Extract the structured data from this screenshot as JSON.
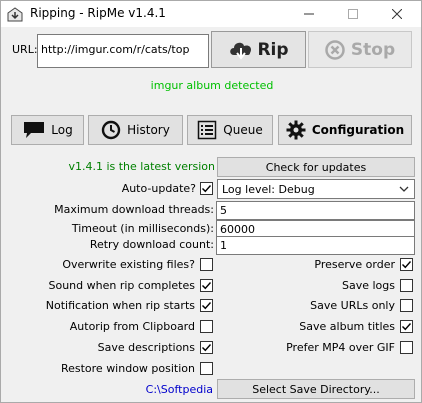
{
  "window": {
    "title": "Ripping - RipMe v1.4.1"
  },
  "url": {
    "label": "URL:",
    "value": "http://imgur.com/r/cats/top"
  },
  "rip_button": {
    "label": "Rip",
    "icon": "cloud-download-icon"
  },
  "stop_button": {
    "label": "Stop",
    "icon": "cancel-icon"
  },
  "status": {
    "text": "imgur album detected",
    "color": "#00c000"
  },
  "tabs": [
    {
      "label": "Log",
      "icon": "speech-bubble-icon"
    },
    {
      "label": "History",
      "icon": "clock-icon"
    },
    {
      "label": "Queue",
      "icon": "list-icon"
    },
    {
      "label": "Configuration",
      "icon": "gear-icon"
    }
  ],
  "config": {
    "version_text": "v1.4.1 is the latest version",
    "version_color": "#008000",
    "check_updates_label": "Check for updates",
    "auto_update_label": "Auto-update?",
    "auto_update_checked": true,
    "log_level_value": "Log level: Debug",
    "threads_label": "Maximum download threads:",
    "threads_value": "5",
    "timeout_label": "Timeout (in milliseconds):",
    "timeout_value": "60000",
    "retry_label": "Retry download count:",
    "retry_value": "1",
    "left_options": [
      {
        "label": "Overwrite existing files?",
        "checked": false
      },
      {
        "label": "Sound when rip completes",
        "checked": true
      },
      {
        "label": "Notification when rip starts",
        "checked": true
      },
      {
        "label": "Autorip from Clipboard",
        "checked": false
      },
      {
        "label": "Save descriptions",
        "checked": true
      },
      {
        "label": "Restore window position",
        "checked": false
      }
    ],
    "right_options": [
      {
        "label": "Preserve order",
        "checked": true
      },
      {
        "label": "Save logs",
        "checked": false
      },
      {
        "label": "Save URLs only",
        "checked": false
      },
      {
        "label": "Save album titles",
        "checked": true
      },
      {
        "label": "Prefer MP4 over GIF",
        "checked": false
      }
    ],
    "save_dir_value": "C:\\Softpedia",
    "save_dir_color": "#0000cc",
    "select_dir_label": "Select Save Directory..."
  }
}
